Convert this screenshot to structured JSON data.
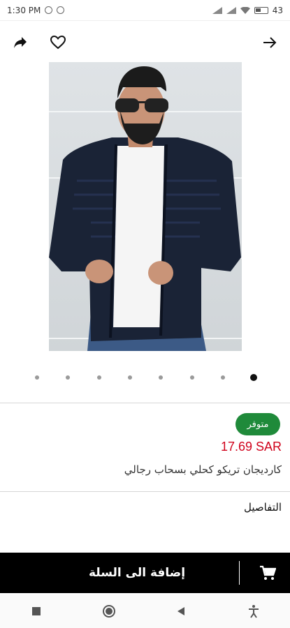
{
  "status_bar": {
    "time": "1:30 PM",
    "battery_text": "43"
  },
  "header": {
    "share_icon": "share-icon",
    "favorite_icon": "heart-icon",
    "back_icon": "arrow-right-icon"
  },
  "gallery": {
    "image_alt": "man wearing navy cardigan",
    "dot_count": 8,
    "active_index": 7
  },
  "product": {
    "availability": "متوفر",
    "price": "17.69 SAR",
    "title": "كارديجان تريكو كحلي بسحاب رجالي",
    "details_label": "التفاصيل",
    "badge_color": "#1f8a3a",
    "price_color": "#d0021b"
  },
  "cart": {
    "button_label": "إضافة الى السلة",
    "icon": "cart-icon"
  },
  "system_nav": {
    "buttons": [
      "square-icon",
      "home-circle-icon",
      "back-triangle-icon",
      "accessibility-icon"
    ]
  }
}
